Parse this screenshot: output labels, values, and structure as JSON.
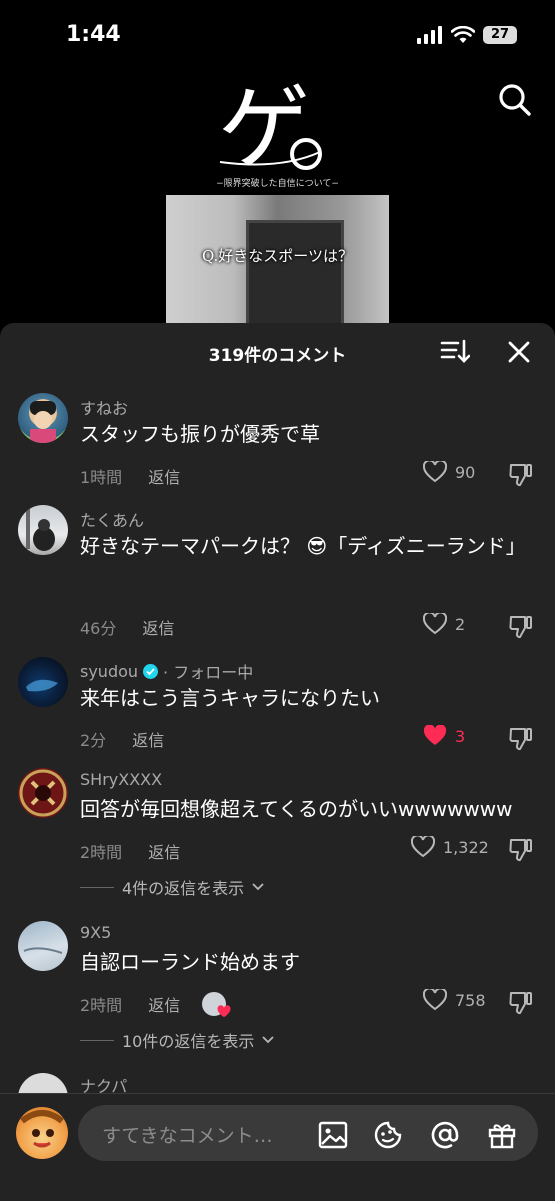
{
  "status": {
    "time": "1:44",
    "battery": "27"
  },
  "video": {
    "logo_text": "ゲ",
    "logo_subtitle": "−限界突破した自信について−",
    "caption": "Q.好きなスポーツは？"
  },
  "sheet": {
    "comment_count": "319件のコメント"
  },
  "comments": [
    {
      "username": "すねお",
      "text": "スタッフも振りが優秀で草",
      "time": "1時間",
      "reply": "返信",
      "likes": "90",
      "liked": false
    },
    {
      "username": "たくあん",
      "text": "好きなテーマパークは？ 😎「ディズニーランド」",
      "time": "46分",
      "reply": "返信",
      "likes": "2",
      "liked": false
    },
    {
      "username": "syudou",
      "following": "· フォロー中",
      "text": "来年はこう言うキャラになりたい",
      "time": "2分",
      "reply": "返信",
      "likes": "3",
      "liked": true
    },
    {
      "username": "SHryXXXX",
      "text": "回答が毎回想像超えてくるのがいいwwwwwww",
      "time": "2時間",
      "reply": "返信",
      "likes": "1,322",
      "liked": false,
      "view_replies": "4件の返信を表示"
    },
    {
      "username": "9X5",
      "text": "自認ローランド始めます",
      "time": "2時間",
      "reply": "返信",
      "likes": "758",
      "liked": false,
      "view_replies": "10件の返信を表示"
    },
    {
      "username": "ナクパ"
    }
  ],
  "composer": {
    "placeholder": "すてきなコメント…"
  },
  "colors": {
    "sheet_bg": "#232323",
    "accent_red": "#fe2c55",
    "verified": "#20d5ec"
  },
  "icons": [
    "search-icon",
    "sort-icon",
    "close-icon",
    "heart-icon",
    "dislike-icon",
    "image-icon",
    "emoji-icon",
    "mention-icon",
    "gift-icon",
    "chevron-down-icon"
  ]
}
